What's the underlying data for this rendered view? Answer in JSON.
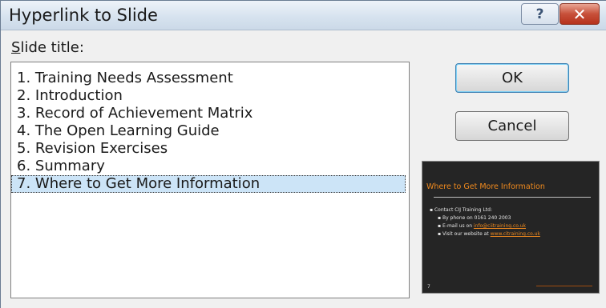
{
  "dialog": {
    "title": "Hyperlink to Slide",
    "help_glyph": "?",
    "close_glyph": "✕"
  },
  "list": {
    "label_accel": "S",
    "label_rest": "lide title:",
    "items": [
      "1. Training Needs Assessment",
      "2. Introduction",
      "3. Record of Achievement Matrix",
      "4. The Open Learning Guide",
      "5. Revision Exercises",
      "6. Summary",
      "7. Where to Get More Information"
    ],
    "selected_index": 6
  },
  "buttons": {
    "ok": "OK",
    "cancel": "Cancel"
  },
  "preview": {
    "title": "Where to Get More Information",
    "line1": "Contact CIJ Training Ltd:",
    "line2": "By phone on 0161 240 2003",
    "line3_prefix": "E-mail us on ",
    "line3_link": "info@ciitraining.co.uk",
    "line4_prefix": "Visit our website at ",
    "line4_link": "www.citraining.co.uk",
    "slide_number": "7",
    "colors": {
      "background": "#252525",
      "accent": "#f08a1e"
    }
  }
}
